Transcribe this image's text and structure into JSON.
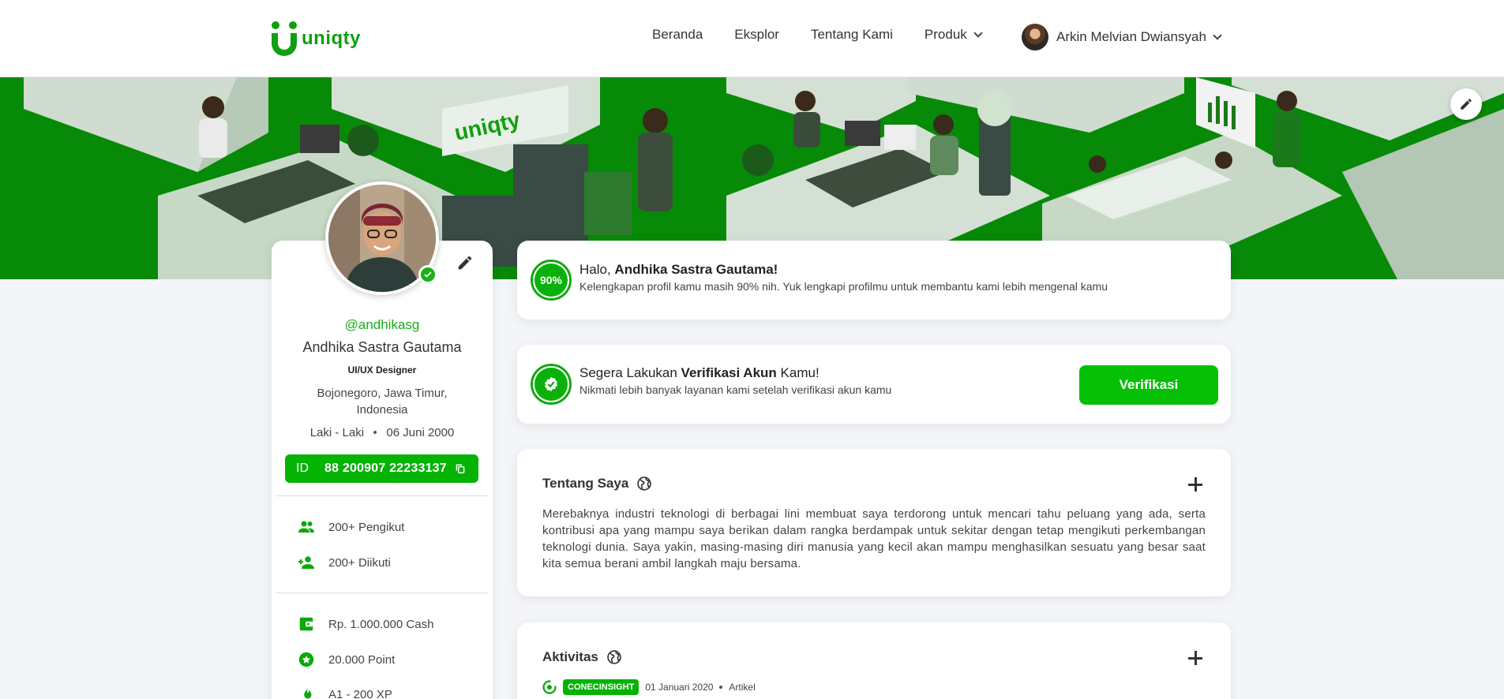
{
  "brand": {
    "name": "uniqty",
    "accent": "#05b305"
  },
  "nav": {
    "items": [
      "Beranda",
      "Eksplor",
      "Tentang Kami"
    ],
    "product_label": "Produk",
    "user_name": "Arkin Melvian Dwiansyah"
  },
  "banner": {
    "sign_text": "uniqty"
  },
  "profile": {
    "handle": "@andhikasg",
    "name": "Andhika Sastra Gautama",
    "role": "UI/UX Designer",
    "location": "Bojonegoro, Jawa Timur, Indonesia",
    "gender": "Laki - Laki",
    "birthdate": "06 Juni 2000",
    "id_label": "ID",
    "id_number": "88 200907 22233137",
    "followers": "200+ Pengikut",
    "following": "200+ Diikuti",
    "cash": "Rp. 1.000.000 Cash",
    "points": "20.000 Point",
    "xp": "A1 - 200 XP"
  },
  "completion": {
    "percent_label": "90%",
    "percent": 90,
    "greeting_prefix": "Halo, ",
    "greeting_name": "Andhika Sastra Gautama!",
    "message": "Kelengkapan profil kamu masih 90% nih. Yuk lengkapi profilmu untuk membantu kami lebih mengenal kamu"
  },
  "verification": {
    "title_prefix": "Segera Lakukan ",
    "title_bold": "Verifikasi Akun",
    "title_suffix": " Kamu!",
    "message": "Nikmati lebih banyak layanan kami setelah verifikasi akun kamu",
    "button_label": "Verifikasi"
  },
  "about": {
    "title": "Tentang Saya",
    "text": "Merebaknya industri teknologi di berbagai lini membuat saya terdorong untuk mencari tahu peluang yang ada, serta kontribusi apa yang mampu saya berikan dalam rangka berdampak untuk sekitar dengan tetap mengikuti perkembangan teknologi dunia. Saya yakin, masing-masing diri manusia yang kecil akan mampu menghasilkan sesuatu yang besar saat kita semua berani ambil langkah maju bersama."
  },
  "activity": {
    "title": "Aktivitas",
    "items": [
      {
        "tag": "CONECINSIGHT",
        "date": "01 Januari 2020",
        "type": "Artikel"
      }
    ]
  }
}
